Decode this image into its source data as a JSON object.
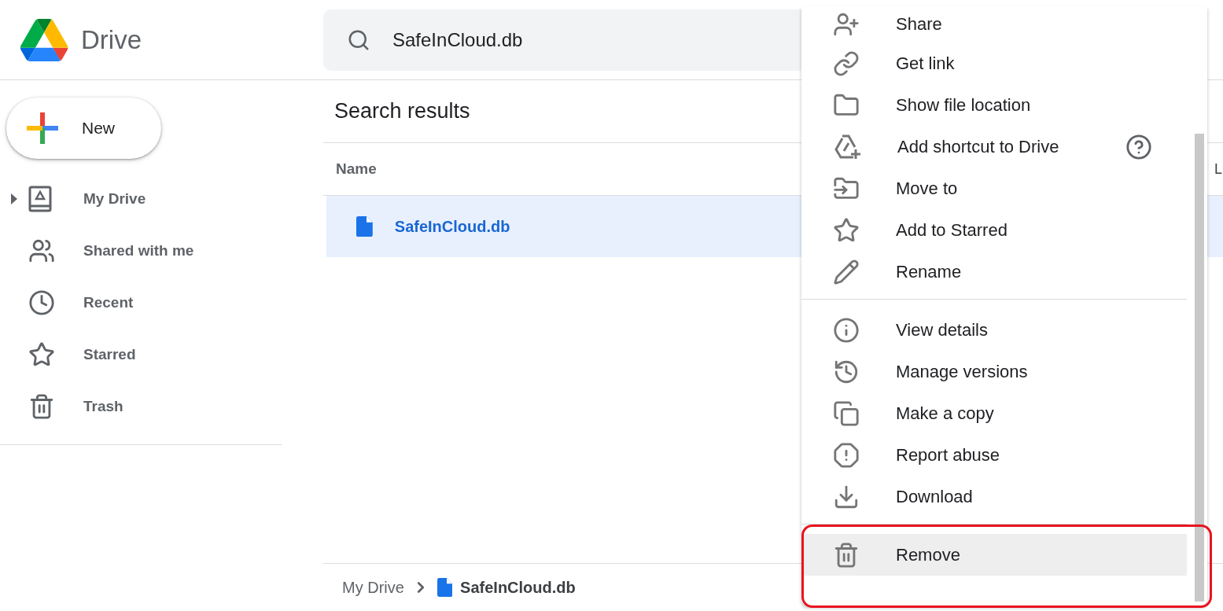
{
  "app": {
    "name": "Drive"
  },
  "search": {
    "value": "SafeInCloud.db"
  },
  "new_button": {
    "label": "New"
  },
  "sidebar": {
    "items": [
      {
        "label": "My Drive",
        "has_children": true,
        "selected": false
      },
      {
        "label": "Shared with me",
        "has_children": false,
        "selected": false
      },
      {
        "label": "Recent",
        "has_children": false,
        "selected": false
      },
      {
        "label": "Starred",
        "has_children": false,
        "selected": false
      },
      {
        "label": "Trash",
        "has_children": false,
        "selected": false
      }
    ]
  },
  "main": {
    "title": "Search results",
    "table": {
      "columns": [
        "Name",
        "L"
      ],
      "rows": [
        {
          "name": "SafeInCloud.db",
          "selected": true
        }
      ]
    },
    "breadcrumb": [
      {
        "label": "My Drive"
      },
      {
        "label": "SafeInCloud.db"
      }
    ]
  },
  "context_menu": {
    "groups": [
      [
        {
          "label": "Share",
          "highlighted": false,
          "has_help": false
        },
        {
          "label": "Get link",
          "highlighted": false,
          "has_help": false
        },
        {
          "label": "Show file location",
          "highlighted": false,
          "has_help": false
        },
        {
          "label": "Add shortcut to Drive",
          "highlighted": false,
          "has_help": true
        },
        {
          "label": "Move to",
          "highlighted": false,
          "has_help": false
        },
        {
          "label": "Add to Starred",
          "highlighted": false,
          "has_help": false
        },
        {
          "label": "Rename",
          "highlighted": false,
          "has_help": false
        }
      ],
      [
        {
          "label": "View details",
          "highlighted": false,
          "has_help": false
        },
        {
          "label": "Manage versions",
          "highlighted": false,
          "has_help": false
        },
        {
          "label": "Make a copy",
          "highlighted": false,
          "has_help": false
        },
        {
          "label": "Report abuse",
          "highlighted": false,
          "has_help": false
        },
        {
          "label": "Download",
          "highlighted": false,
          "has_help": false
        }
      ],
      [
        {
          "label": "Remove",
          "highlighted": true,
          "has_help": false
        }
      ]
    ]
  }
}
